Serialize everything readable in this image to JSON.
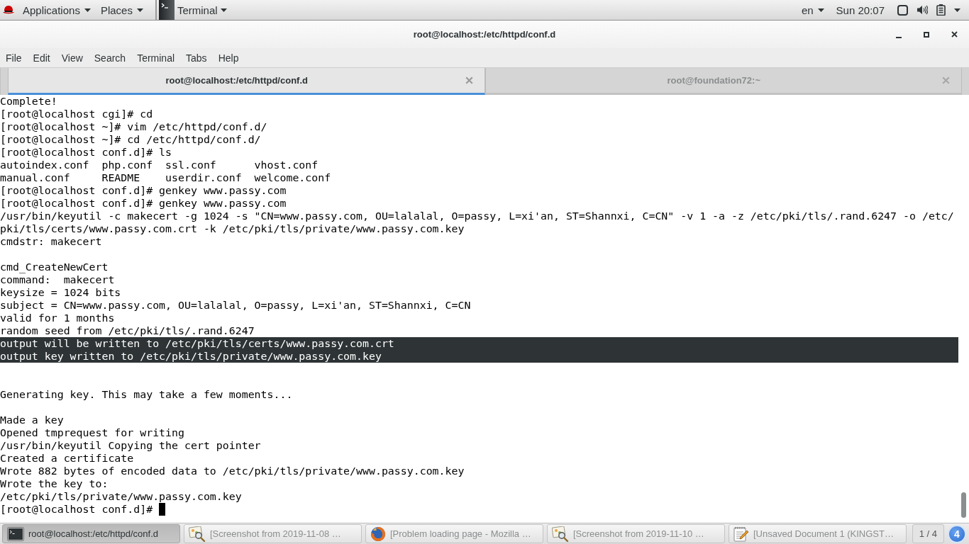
{
  "top_bar": {
    "menus": [
      {
        "label": "Applications"
      },
      {
        "label": "Places"
      }
    ],
    "app_menu": {
      "label": "Terminal"
    },
    "language": "en",
    "clock": "Sun 20:07"
  },
  "window": {
    "title": "root@localhost:/etc/httpd/conf.d"
  },
  "menu_bar": [
    {
      "label": "File"
    },
    {
      "label": "Edit"
    },
    {
      "label": "View"
    },
    {
      "label": "Search"
    },
    {
      "label": "Terminal"
    },
    {
      "label": "Tabs"
    },
    {
      "label": "Help"
    }
  ],
  "tabs": [
    {
      "label": "root@localhost:/etc/httpd/conf.d",
      "selected": true
    },
    {
      "label": "root@foundation72:~",
      "selected": false
    }
  ],
  "terminal": {
    "lines": [
      {
        "kind": "text",
        "text": "Complete!",
        "selected": false
      },
      {
        "kind": "text",
        "text": "[root@localhost cgi]# cd",
        "selected": false
      },
      {
        "kind": "text",
        "text": "[root@localhost ~]# vim /etc/httpd/conf.d/",
        "selected": false
      },
      {
        "kind": "text",
        "text": "[root@localhost ~]# cd /etc/httpd/conf.d/",
        "selected": false
      },
      {
        "kind": "text",
        "text": "[root@localhost conf.d]# ls",
        "selected": false
      },
      {
        "kind": "text",
        "text": "autoindex.conf  php.conf  ssl.conf      vhost.conf",
        "selected": false
      },
      {
        "kind": "text",
        "text": "manual.conf     README    userdir.conf  welcome.conf",
        "selected": false
      },
      {
        "kind": "text",
        "text": "[root@localhost conf.d]# genkey www.passy.com",
        "selected": false
      },
      {
        "kind": "text",
        "text": "[root@localhost conf.d]# genkey www.passy.com",
        "selected": false
      },
      {
        "kind": "text",
        "text": "/usr/bin/keyutil -c makecert -g 1024 -s \"CN=www.passy.com, OU=lalalal, O=passy, L=xi'an, ST=Shannxi, C=CN\" -v 1 -a -z /etc/pki/tls/.rand.6247 -o /etc/",
        "selected": false
      },
      {
        "kind": "text",
        "text": "pki/tls/certs/www.passy.com.crt -k /etc/pki/tls/private/www.passy.com.key",
        "selected": false
      },
      {
        "kind": "text",
        "text": "cmdstr: makecert",
        "selected": false
      },
      {
        "kind": "blank",
        "selected": false
      },
      {
        "kind": "text",
        "text": "cmd_CreateNewCert",
        "selected": false
      },
      {
        "kind": "text",
        "text": "command:  makecert",
        "selected": false
      },
      {
        "kind": "text",
        "text": "keysize = 1024 bits",
        "selected": false
      },
      {
        "kind": "text",
        "text": "subject = CN=www.passy.com, OU=lalalal, O=passy, L=xi'an, ST=Shannxi, C=CN",
        "selected": false
      },
      {
        "kind": "text",
        "text": "valid for 1 months",
        "selected": false
      },
      {
        "kind": "text",
        "text": "random seed from /etc/pki/tls/.rand.6247",
        "selected": false
      },
      {
        "kind": "text",
        "text": "output will be written to /etc/pki/tls/certs/www.passy.com.crt",
        "selected": true
      },
      {
        "kind": "text",
        "text": "output key written to /etc/pki/tls/private/www.passy.com.key",
        "selected": true
      },
      {
        "kind": "blank",
        "selected": false
      },
      {
        "kind": "blank",
        "selected": false
      },
      {
        "kind": "text",
        "text": "Generating key. This may take a few moments...",
        "selected": false
      },
      {
        "kind": "blank",
        "selected": false
      },
      {
        "kind": "text",
        "text": "Made a key",
        "selected": false
      },
      {
        "kind": "text",
        "text": "Opened tmprequest for writing",
        "selected": false
      },
      {
        "kind": "text",
        "text": "/usr/bin/keyutil Copying the cert pointer",
        "selected": false
      },
      {
        "kind": "text",
        "text": "Created a certificate",
        "selected": false
      },
      {
        "kind": "text",
        "text": "Wrote 882 bytes of encoded data to /etc/pki/tls/private/www.passy.com.key",
        "selected": false
      },
      {
        "kind": "text",
        "text": "Wrote the key to:",
        "selected": false
      },
      {
        "kind": "text",
        "text": "/etc/pki/tls/private/www.passy.com.key",
        "selected": false
      },
      {
        "kind": "text",
        "text": "[root@localhost conf.d]#",
        "selected": false
      }
    ],
    "cursor": true
  },
  "taskbar": {
    "windows": [
      {
        "kind": "terminal",
        "title": "root@localhost:/etc/httpd/conf.d",
        "selected": true
      },
      {
        "kind": "image_viewer",
        "title": "[Screenshot from 2019-11-08 …",
        "selected": false
      },
      {
        "kind": "browser",
        "title": "[Problem loading page - Mozilla …",
        "selected": false
      },
      {
        "kind": "image_viewer",
        "title": "[Screenshot from 2019-11-10 …",
        "selected": false
      },
      {
        "kind": "text_editor",
        "title": "[Unsaved Document 1 (KINGST…",
        "selected": false
      }
    ],
    "workspace": "1 / 4",
    "notification_count": "4"
  }
}
